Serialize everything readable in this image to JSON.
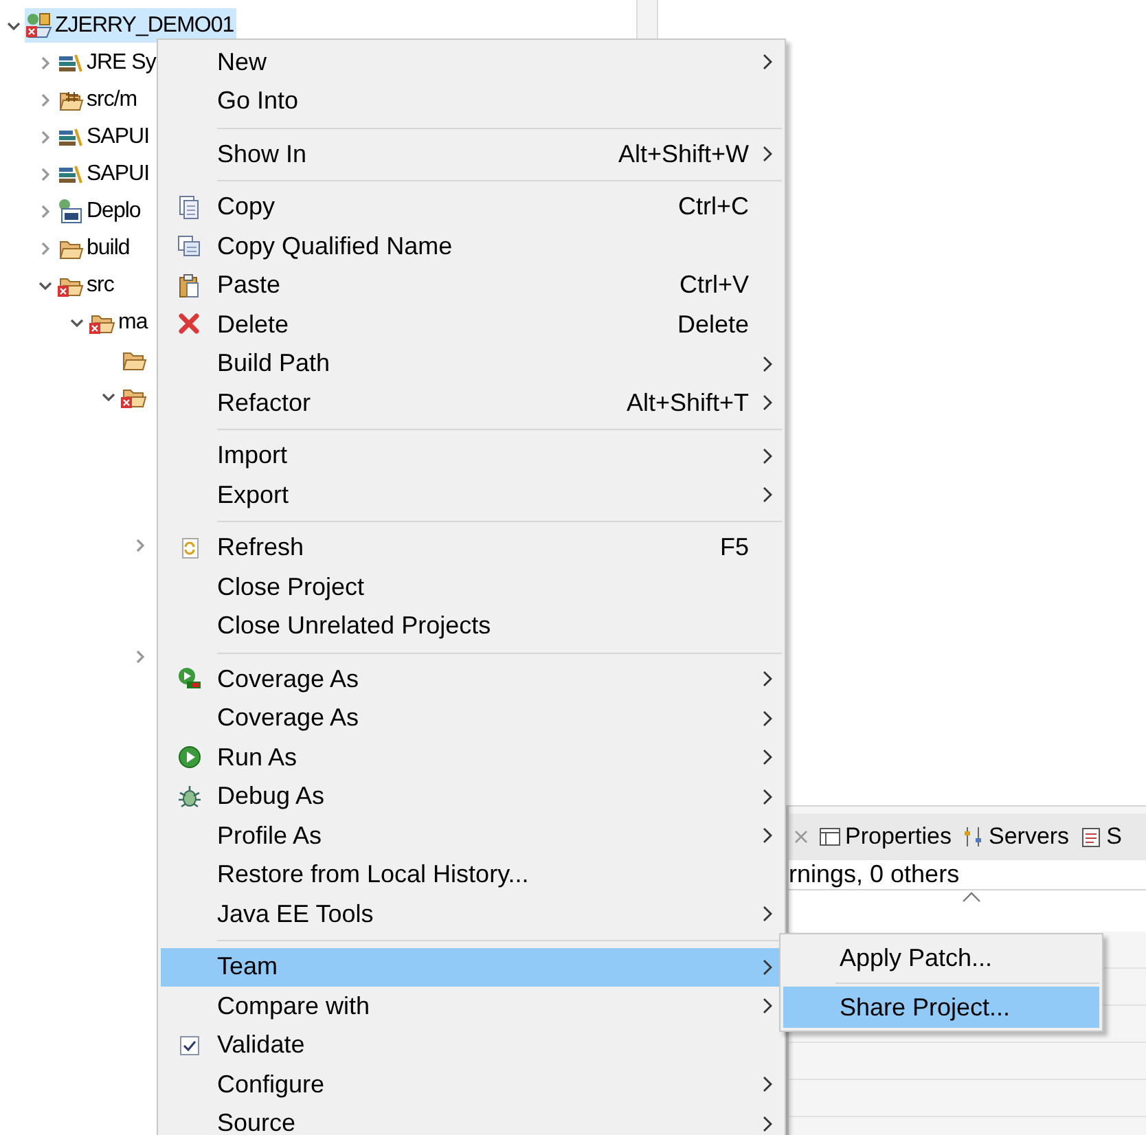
{
  "tree": [
    {
      "label": "ZJERRY_DEMO01",
      "kind": "project",
      "expandable": true,
      "expanded": true,
      "selected": true,
      "children": [
        {
          "label": "JRE Sy",
          "kind": "library",
          "expandable": true,
          "expanded": false,
          "selected": false
        },
        {
          "label": "src/m",
          "kind": "package-folder",
          "expandable": true,
          "expanded": false,
          "selected": false
        },
        {
          "label": "SAPUI",
          "kind": "library",
          "expandable": true,
          "expanded": false,
          "selected": false
        },
        {
          "label": "SAPUI",
          "kind": "library",
          "expandable": true,
          "expanded": false,
          "selected": false
        },
        {
          "label": "Deplo",
          "kind": "deploy",
          "expandable": true,
          "expanded": false,
          "selected": false
        },
        {
          "label": "build",
          "kind": "folder",
          "expandable": true,
          "expanded": false,
          "selected": false
        },
        {
          "label": "src",
          "kind": "error-folder",
          "expandable": true,
          "expanded": true,
          "selected": false,
          "children": [
            {
              "label": "ma",
              "kind": "error-folder",
              "expandable": true,
              "expanded": true,
              "selected": false,
              "children": [
                {
                  "kind": "folder",
                  "expandable": false,
                  "expanded": false,
                  "selected": false
                },
                {
                  "kind": "error-folder",
                  "expandable": true,
                  "expanded": true,
                  "selected": false,
                  "children": [
                    {
                      "expandable": true,
                      "expanded": false,
                      "selected": false
                    },
                    {
                      "expandable": true,
                      "expanded": false,
                      "selected": false
                    }
                  ]
                }
              ]
            }
          ]
        }
      ]
    }
  ],
  "context_menu": [
    {
      "kind": "plain",
      "label": "New",
      "submenu": true,
      "selected": false
    },
    {
      "kind": "plain",
      "label": "Go Into",
      "submenu": false,
      "selected": false
    },
    {
      "kind": "separator"
    },
    {
      "kind": "plain",
      "label": "Show In",
      "shortcut": "Alt+Shift+W",
      "submenu": true,
      "selected": false
    },
    {
      "kind": "separator"
    },
    {
      "kind": "copy",
      "label": "Copy",
      "shortcut": "Ctrl+C",
      "submenu": false,
      "selected": false
    },
    {
      "kind": "copy-qualified",
      "label": "Copy Qualified Name",
      "submenu": false,
      "selected": false
    },
    {
      "kind": "paste",
      "label": "Paste",
      "shortcut": "Ctrl+V",
      "submenu": false,
      "selected": false
    },
    {
      "kind": "delete",
      "label": "Delete",
      "shortcut": "Delete",
      "submenu": false,
      "selected": false
    },
    {
      "kind": "plain",
      "label": "Build Path",
      "submenu": true,
      "selected": false
    },
    {
      "kind": "plain",
      "label": "Refactor",
      "shortcut": "Alt+Shift+T",
      "submenu": true,
      "selected": false
    },
    {
      "kind": "separator"
    },
    {
      "kind": "plain",
      "label": "Import",
      "submenu": true,
      "selected": false
    },
    {
      "kind": "plain",
      "label": "Export",
      "submenu": true,
      "selected": false
    },
    {
      "kind": "separator"
    },
    {
      "kind": "refresh",
      "label": "Refresh",
      "shortcut": "F5",
      "submenu": false,
      "selected": false
    },
    {
      "kind": "plain",
      "label": "Close Project",
      "submenu": false,
      "selected": false
    },
    {
      "kind": "plain",
      "label": "Close Unrelated Projects",
      "submenu": false,
      "selected": false
    },
    {
      "kind": "separator"
    },
    {
      "kind": "coverage",
      "label": "Coverage As",
      "submenu": true,
      "selected": false
    },
    {
      "kind": "plain",
      "label": "Coverage As",
      "submenu": true,
      "selected": false
    },
    {
      "kind": "run",
      "label": "Run As",
      "submenu": true,
      "selected": false
    },
    {
      "kind": "debug",
      "label": "Debug As",
      "submenu": true,
      "selected": false
    },
    {
      "kind": "plain",
      "label": "Profile As",
      "submenu": true,
      "selected": false
    },
    {
      "kind": "plain",
      "label": "Restore from Local History...",
      "submenu": false,
      "selected": false
    },
    {
      "kind": "plain",
      "label": "Java EE Tools",
      "submenu": true,
      "selected": false
    },
    {
      "kind": "separator"
    },
    {
      "kind": "plain",
      "label": "Team",
      "submenu": true,
      "selected": true
    },
    {
      "kind": "plain",
      "label": "Compare with",
      "submenu": true,
      "selected": false
    },
    {
      "kind": "check",
      "label": "Validate",
      "checked": true,
      "submenu": false,
      "selected": false
    },
    {
      "kind": "plain",
      "label": "Configure",
      "submenu": true,
      "selected": false
    },
    {
      "kind": "plain",
      "label": "Source",
      "submenu": true,
      "selected": false
    }
  ],
  "team_submenu": [
    {
      "kind": "item",
      "label": "Apply Patch...",
      "selected": false
    },
    {
      "kind": "separator"
    },
    {
      "kind": "item",
      "label": "Share Project...",
      "selected": true
    }
  ],
  "bottom_panel": {
    "tabs": [
      {
        "label": "Properties",
        "kind": "properties",
        "selected": false
      },
      {
        "label": "Servers",
        "kind": "servers",
        "selected": false
      },
      {
        "label": "S",
        "kind": "snippets",
        "selected": false
      }
    ],
    "status": "rnings, 0 others"
  }
}
